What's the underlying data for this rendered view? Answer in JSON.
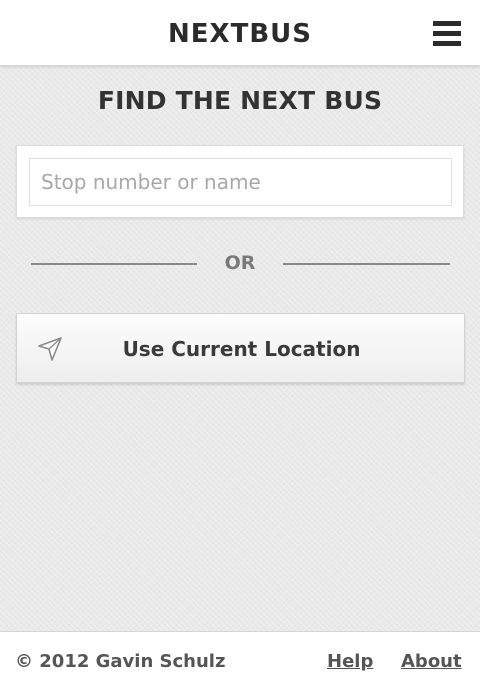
{
  "header": {
    "title": "NEXTBUS",
    "menu_icon": "hamburger-menu-icon"
  },
  "main": {
    "heading": "FIND THE NEXT BUS",
    "search": {
      "placeholder": "Stop number or name",
      "value": ""
    },
    "divider_text": "OR",
    "location_button": {
      "label": "Use Current Location",
      "icon": "navigation-arrow-icon"
    }
  },
  "footer": {
    "copyright": "© 2012 Gavin Schulz",
    "links": [
      {
        "label": "Help"
      },
      {
        "label": "About"
      }
    ]
  },
  "colors": {
    "background": "#e9e9e9",
    "text_dark": "#333333",
    "text_muted": "#7a7a7a",
    "divider": "#8a8a8a"
  }
}
